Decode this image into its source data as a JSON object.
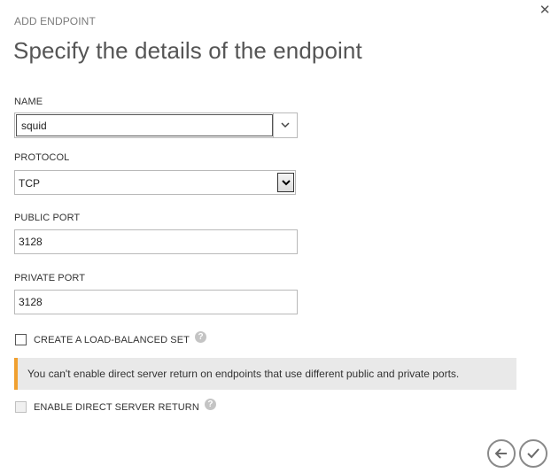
{
  "dialog": {
    "eyebrow": "ADD ENDPOINT",
    "title": "Specify the details of the endpoint",
    "close_icon": "close-icon",
    "close_glyph": "✕"
  },
  "form": {
    "name": {
      "label": "NAME",
      "value": "squid"
    },
    "protocol": {
      "label": "PROTOCOL",
      "selected": "TCP"
    },
    "public_port": {
      "label": "PUBLIC PORT",
      "value": "3128"
    },
    "private_port": {
      "label": "PRIVATE PORT",
      "value": "3128"
    },
    "load_balanced": {
      "label": "CREATE A LOAD-BALANCED SET",
      "checked": false
    },
    "warning": {
      "text": "You can't enable direct server return on endpoints that use different public and private ports.",
      "accent_color": "#f0a030"
    },
    "direct_server_return": {
      "label": "ENABLE DIRECT SERVER RETURN",
      "checked": false,
      "disabled": true
    },
    "help_glyph": "?"
  },
  "footer": {
    "back_icon": "arrow-left-icon",
    "confirm_icon": "checkmark-icon"
  }
}
